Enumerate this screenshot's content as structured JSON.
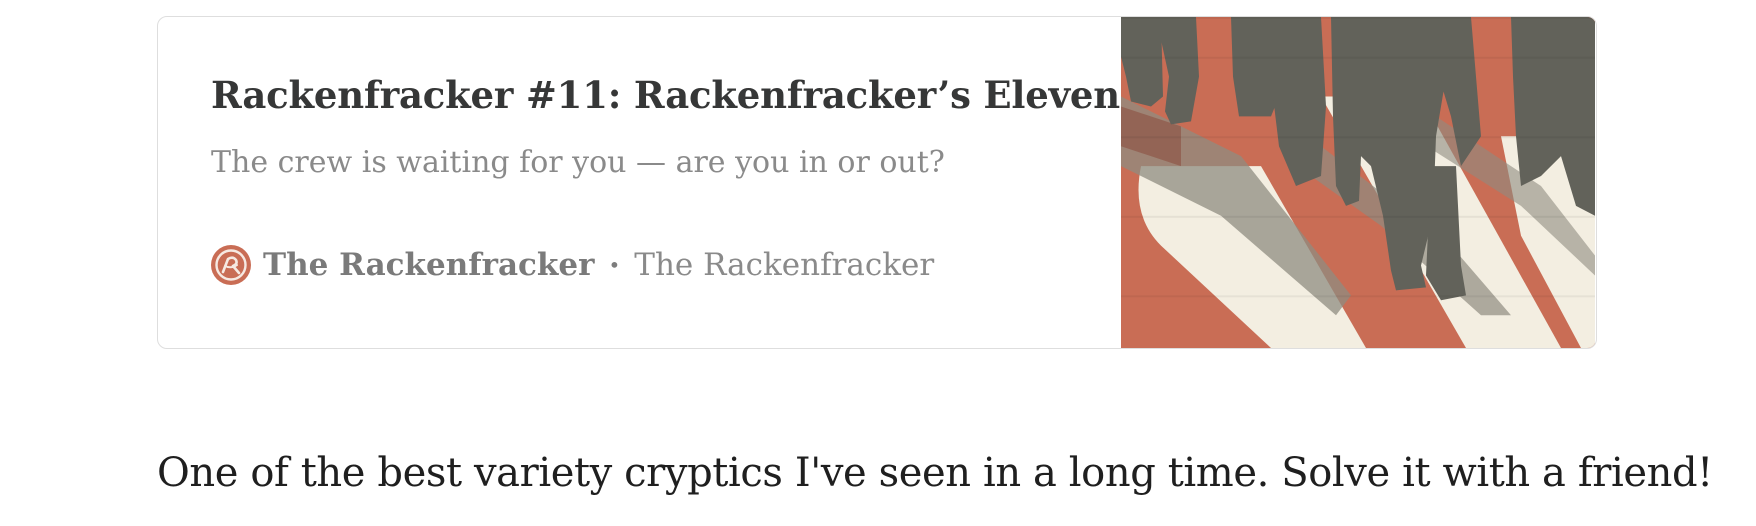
{
  "embed": {
    "title": "Rackenfracker #11: Rackenfracker’s Eleven",
    "subtitle": "The crew is waiting for you — are you in or out?",
    "publication": "The Rackenfracker",
    "separator": "•",
    "author": "The Rackenfracker",
    "logo_icon": "rackenfracker-logo-icon",
    "image_description_icon": "crowd-of-legs-illustration",
    "colors": {
      "accent": "#c96d55",
      "cream": "#f3eee1",
      "figure": "#62625a",
      "title": "#363737",
      "muted": "#8a8a8a",
      "border": "#dedede"
    }
  },
  "body": {
    "text": "One of the best variety cryptics I've seen in a long time. Solve it with a friend!"
  }
}
